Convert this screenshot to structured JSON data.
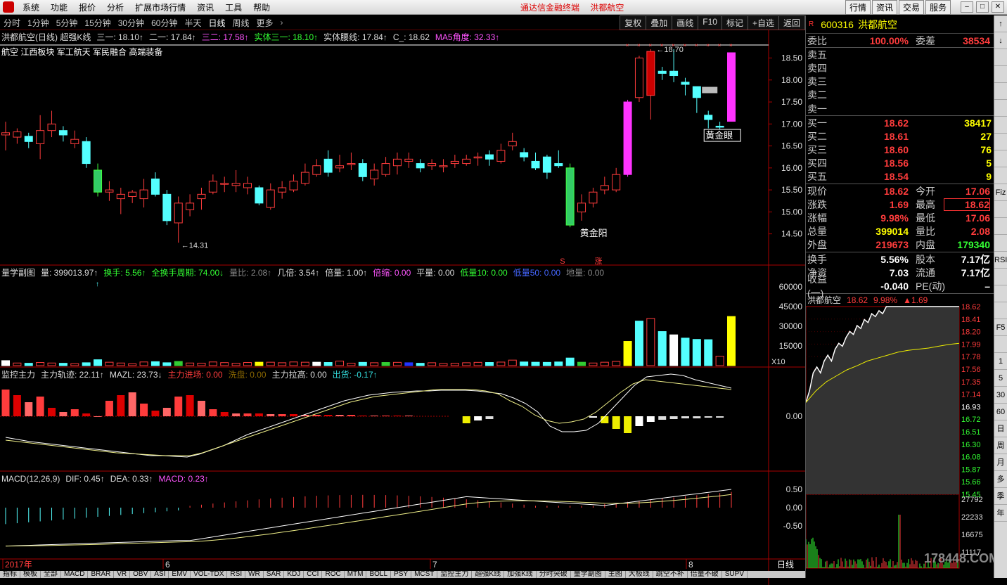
{
  "menubar": {
    "items": [
      "系统",
      "功能",
      "报价",
      "分析",
      "扩展市场行情",
      "资讯",
      "工具",
      "帮助"
    ],
    "center": [
      "通达信金融终端",
      "洪都航空"
    ],
    "right_buttons": [
      "行情",
      "资讯",
      "交易",
      "服务"
    ]
  },
  "periods": [
    "分时",
    "1分钟",
    "5分钟",
    "15分钟",
    "30分钟",
    "60分钟",
    "半天",
    "日线",
    "周线",
    "更多",
    "›"
  ],
  "toolbar": [
    "复权",
    "叠加",
    "画线",
    "F10",
    "标记",
    "+自选",
    "返回"
  ],
  "main_chart": {
    "title_parts": [
      {
        "t": "洪都航空(日线) 超强K线",
        "c": "#dddddd"
      },
      {
        "t": "三一: 18.10↑",
        "c": "#dddddd"
      },
      {
        "t": "二一: 17.84↑",
        "c": "#dddddd"
      },
      {
        "t": "三二: 17.58↑",
        "c": "#ff55ff"
      },
      {
        "t": "实体三一: 18.10↑",
        "c": "#33ff33"
      },
      {
        "t": "实体腰线: 17.84↑",
        "c": "#dddddd"
      },
      {
        "t": "C_: 18.62",
        "c": "#dddddd"
      },
      {
        "t": "MA5角度: 32.33↑",
        "c": "#ff55ff"
      }
    ],
    "sectors": "航空     江西板块  军工航天 军民融合 高端装备",
    "y_ticks": [
      "18.50",
      "18.00",
      "17.50",
      "17.00",
      "16.50",
      "16.00",
      "15.50",
      "15.00",
      "14.50"
    ],
    "high_label": "18.70",
    "low_label": "14.31",
    "annotations": [
      "黄金阳",
      "黄金眼"
    ],
    "markers": [
      "S",
      "涨"
    ]
  },
  "volume_panel": {
    "title_parts": [
      {
        "t": "量学副图",
        "c": "#dddddd"
      },
      {
        "t": "量: 399013.97↑",
        "c": "#dddddd"
      },
      {
        "t": "换手: 5.56↑",
        "c": "#33ff33"
      },
      {
        "t": "全换手周期: 74.00↓",
        "c": "#33ff33"
      },
      {
        "t": "量比: 2.08↑",
        "c": "#888888"
      },
      {
        "t": "几倍: 3.54↑",
        "c": "#dddddd"
      },
      {
        "t": "倍量: 1.00↑",
        "c": "#dddddd"
      },
      {
        "t": "倍缩: 0.00",
        "c": "#ff55ff"
      },
      {
        "t": "平量: 0.00",
        "c": "#dddddd"
      },
      {
        "t": "低量10: 0.00",
        "c": "#33ff33"
      },
      {
        "t": "低量50: 0.00",
        "c": "#4466ff"
      },
      {
        "t": "地量: 0.00",
        "c": "#888888"
      }
    ],
    "y_ticks": [
      "60000",
      "45000",
      "30000",
      "15000"
    ],
    "scale": "X10"
  },
  "monitor_panel": {
    "title_parts": [
      {
        "t": "监控主力",
        "c": "#dddddd"
      },
      {
        "t": "主力轨迹: 22.11↑",
        "c": "#dddddd"
      },
      {
        "t": "MAZL: 23.73↓",
        "c": "#dddddd"
      },
      {
        "t": "主力进场: 0.00",
        "c": "#ff3c3c"
      },
      {
        "t": "洗盘: 0.00",
        "c": "#886600"
      },
      {
        "t": "主力拉高: 0.00",
        "c": "#dddddd"
      },
      {
        "t": "出货: -0.17↑",
        "c": "#33dddd"
      }
    ],
    "y_ticks": [
      "0.00"
    ]
  },
  "macd_panel": {
    "title_parts": [
      {
        "t": "MACD(12,26,9)",
        "c": "#dddddd"
      },
      {
        "t": "DIF: 0.45↑",
        "c": "#dddddd"
      },
      {
        "t": "DEA: 0.33↑",
        "c": "#dddddd"
      },
      {
        "t": "MACD: 0.23↑",
        "c": "#ff55ff"
      }
    ],
    "y_ticks": [
      "0.50",
      "0.00",
      "-0.50"
    ]
  },
  "time_axis": [
    "2017年",
    "6",
    "7",
    "8"
  ],
  "period_label": "日线",
  "quote": {
    "code": "600316",
    "name": "洪都航空",
    "r_badge": "R",
    "weibi_label": "委比",
    "weibi": "100.00%",
    "weicha_label": "委差",
    "weicha": "38534",
    "sells": [
      {
        "label": "卖五",
        "price": "",
        "vol": ""
      },
      {
        "label": "卖四",
        "price": "",
        "vol": ""
      },
      {
        "label": "卖三",
        "price": "",
        "vol": ""
      },
      {
        "label": "卖二",
        "price": "",
        "vol": ""
      },
      {
        "label": "卖一",
        "price": "",
        "vol": ""
      }
    ],
    "buys": [
      {
        "label": "买一",
        "price": "18.62",
        "vol": "38417"
      },
      {
        "label": "买二",
        "price": "18.61",
        "vol": "27"
      },
      {
        "label": "买三",
        "price": "18.60",
        "vol": "76"
      },
      {
        "label": "买四",
        "price": "18.56",
        "vol": "5"
      },
      {
        "label": "买五",
        "price": "18.54",
        "vol": "9"
      }
    ],
    "stats": [
      {
        "l1": "现价",
        "v1": "18.62",
        "c1": "red",
        "l2": "今开",
        "v2": "17.06",
        "c2": "red"
      },
      {
        "l1": "涨跌",
        "v1": "1.69",
        "c1": "red",
        "l2": "最高",
        "v2": "18.62",
        "c2": "red"
      },
      {
        "l1": "涨幅",
        "v1": "9.98%",
        "c1": "red",
        "l2": "最低",
        "v2": "17.06",
        "c2": "red"
      },
      {
        "l1": "总量",
        "v1": "399014",
        "c1": "yel",
        "l2": "量比",
        "v2": "2.08",
        "c2": "red"
      },
      {
        "l1": "外盘",
        "v1": "219673",
        "c1": "red",
        "l2": "内盘",
        "v2": "179340",
        "c2": "grn"
      }
    ],
    "stats2": [
      {
        "l1": "换手",
        "v1": "5.56%",
        "l2": "股本",
        "v2": "7.17亿"
      },
      {
        "l1": "净资",
        "v1": "7.03",
        "l2": "流通",
        "v2": "7.17亿"
      },
      {
        "l1": "收益(一)",
        "v1": "-0.040",
        "l2": "PE(动)",
        "v2": "–"
      }
    ]
  },
  "mini_chart": {
    "title_parts": [
      {
        "t": "洪都航空",
        "c": "#dddddd"
      },
      {
        "t": "18.62",
        "c": "#ff3c3c"
      },
      {
        "t": "9.98%",
        "c": "#ff3c3c"
      },
      {
        "t": "▲1.69",
        "c": "#ff3c3c"
      }
    ],
    "price_ticks": [
      "18.62",
      "18.41",
      "18.20",
      "17.99",
      "17.78",
      "17.56",
      "17.35",
      "17.14",
      "16.93",
      "16.72",
      "16.51",
      "16.30",
      "16.08",
      "15.87",
      "15.66",
      "15.45"
    ],
    "vol_ticks": [
      "27792",
      "22233",
      "16675",
      "11117"
    ],
    "watermark": "178448.COM"
  },
  "side_tabs": [
    "↑",
    "↓",
    "",
    "",
    "",
    "",
    "",
    "",
    "",
    "",
    "Fiz",
    "",
    "",
    "",
    "RSI",
    "",
    "",
    "",
    "F5",
    "",
    "1",
    "5",
    "30",
    "60",
    "日",
    "周",
    "月",
    "多",
    "季",
    "年"
  ],
  "bottom_tabs": [
    "指标",
    "模板",
    "全部",
    "MACD",
    "BRAR",
    "VR",
    "OBV",
    "ASI",
    "EMV",
    "VOL-TDX",
    "RSI",
    "WR",
    "SAR",
    "KDJ",
    "CCI",
    "ROC",
    "MTM",
    "BOLL",
    "PSY",
    "MCST",
    "监控主力",
    "超强K线",
    "加强K线",
    "分时突破",
    "量学副图",
    "主图",
    "大极线",
    "跳空不补",
    "倍量不破",
    "SUPV"
  ]
}
